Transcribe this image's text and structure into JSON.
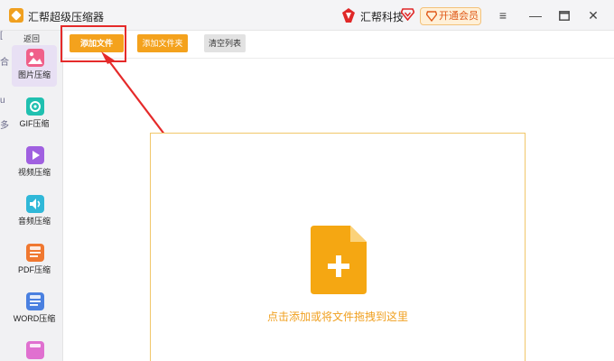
{
  "window": {
    "title": "汇帮超级压缩器",
    "brand": "汇帮科技",
    "vip_label": "开通会员",
    "menu_glyph": "≡",
    "minimize_glyph": "—",
    "close_glyph": "✕"
  },
  "sidebar": {
    "back_label": "返回",
    "items": [
      {
        "label": "图片压缩",
        "icon": "image-icon",
        "color": "#f0608a",
        "active": true
      },
      {
        "label": "GIF压缩",
        "icon": "gif-icon",
        "color": "#20c0b0",
        "active": false
      },
      {
        "label": "视频压缩",
        "icon": "video-icon",
        "color": "#a060e0",
        "active": false
      },
      {
        "label": "音频压缩",
        "icon": "audio-icon",
        "color": "#30b8d8",
        "active": false
      },
      {
        "label": "PDF压缩",
        "icon": "pdf-icon",
        "color": "#f07830",
        "active": false
      },
      {
        "label": "WORD压缩",
        "icon": "word-icon",
        "color": "#4a80e0",
        "active": false
      },
      {
        "label": "",
        "icon": "ppt-icon",
        "color": "#e070d0",
        "active": false
      }
    ],
    "edge_glyphs": [
      "[",
      "合",
      "u",
      "多"
    ]
  },
  "toolbar": {
    "add_file": "添加文件",
    "add_folder": "添加文件夹",
    "clear_list": "清空列表"
  },
  "drop_zone": {
    "hint": "点击添加或将文件拖拽到这里"
  },
  "colors": {
    "accent": "#f4a21d",
    "highlight": "#e52a2a",
    "drop_border": "#f1c76a"
  }
}
